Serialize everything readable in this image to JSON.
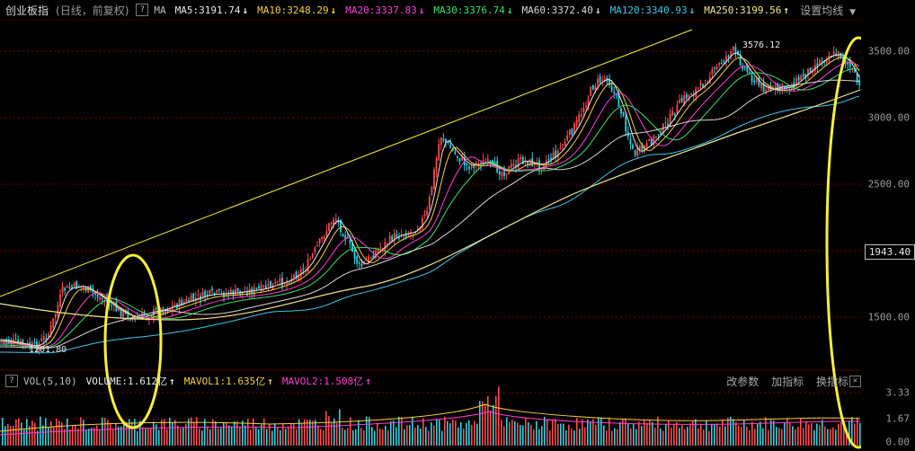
{
  "header": {
    "title": "创业板指",
    "subtitle": "(日线，前复权)",
    "help_label": "?",
    "ma_label": "MA",
    "ma_items": [
      {
        "label": "MA5:3191.74",
        "arrow": "↓",
        "color": "#e8e8e8"
      },
      {
        "label": "MA10:3248.29",
        "arrow": "↓",
        "color": "#f4d03f"
      },
      {
        "label": "MA20:3337.83",
        "arrow": "↓",
        "color": "#ff3fd6"
      },
      {
        "label": "MA30:3376.74",
        "arrow": "↓",
        "color": "#36e36b"
      },
      {
        "label": "MA60:3372.40",
        "arrow": "↓",
        "color": "#d8d8d8"
      },
      {
        "label": "MA120:3340.93",
        "arrow": "↓",
        "color": "#3fc6ea"
      },
      {
        "label": "MA250:3199.56",
        "arrow": "↑",
        "color": "#f2e88a"
      }
    ],
    "settings_label": "设置均线"
  },
  "volume_header": {
    "help_label": "?",
    "indicator_label": "VOL(5,10)",
    "items": [
      {
        "label": "VOLUME:1.612亿",
        "arrow": "↑",
        "color": "#e8e8e8"
      },
      {
        "label": "MAVOL1:1.635亿",
        "arrow": "↑",
        "color": "#f4d03f"
      },
      {
        "label": "MAVOL2:1.508亿",
        "arrow": "↑",
        "color": "#ff3fd6"
      }
    ],
    "menu": [
      "改参数",
      "加指标",
      "换指标"
    ],
    "close_label": "✕"
  },
  "axis": {
    "price_ticks": [
      "3500.00",
      "3000.00",
      "2500.00",
      "1500.00"
    ],
    "current_price": "1943.40",
    "volume_ticks": [
      "3.33",
      "1.67",
      "0.00"
    ]
  },
  "annotations": {
    "high_label": "3576.12",
    "low_label": "1201.80"
  },
  "colors": {
    "up_candle": "#ff4a4a",
    "down_candle": "#2ad4e6",
    "trendline": "#f5f03a",
    "highlight_ellipse": "#f5f03a"
  }
}
